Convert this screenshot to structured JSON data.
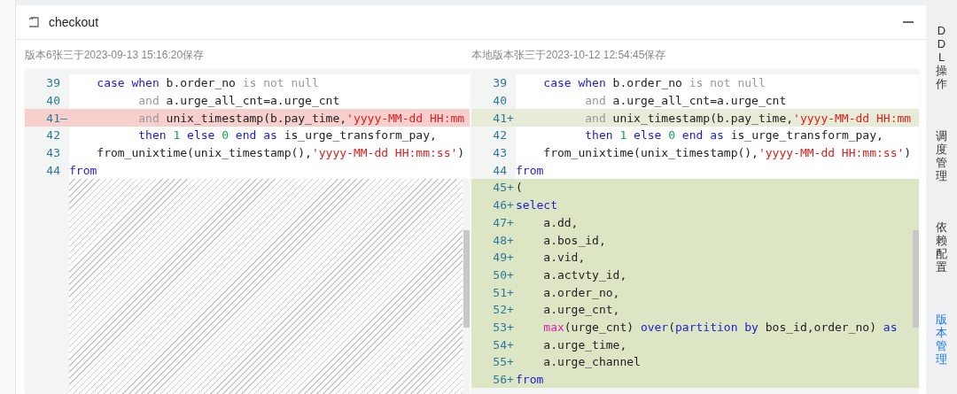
{
  "panel": {
    "title": "checkout"
  },
  "panes": [
    {
      "caption": "版本6张三于2023-09-13 15:16:20保存",
      "filler": true,
      "lines": [
        {
          "number": "39",
          "kind": "context",
          "tokens": [
            {
              "kind": "kw",
              "t": "    case when "
            },
            {
              "kind": "plain",
              "t": "b.order_no "
            },
            {
              "kind": "muted",
              "t": "is not null"
            }
          ]
        },
        {
          "number": "40",
          "kind": "context",
          "tokens": [
            {
              "kind": "muted",
              "t": "          and "
            },
            {
              "kind": "plain",
              "t": "a.urge_all_cnt=a.urge_cnt"
            }
          ]
        },
        {
          "number": "41",
          "marker": "—",
          "kind": "removed",
          "tokens": [
            {
              "kind": "muted",
              "t": "          and "
            },
            {
              "kind": "plain",
              "t": "unix_timestamp(b.pay_time,"
            },
            {
              "kind": "str",
              "t": "'yyyy-MM-dd HH:mm"
            }
          ]
        },
        {
          "number": "42",
          "kind": "context",
          "tokens": [
            {
              "kind": "kw",
              "t": "          then "
            },
            {
              "kind": "num",
              "t": "1 "
            },
            {
              "kind": "kw",
              "t": "else "
            },
            {
              "kind": "num",
              "t": "0 "
            },
            {
              "kind": "kw",
              "t": "end as "
            },
            {
              "kind": "plain",
              "t": "is_urge_transform_pay,"
            }
          ]
        },
        {
          "number": "43",
          "kind": "context",
          "tokens": [
            {
              "kind": "plain",
              "t": "    from_unixtime(unix_timestamp(),"
            },
            {
              "kind": "str",
              "t": "'yyyy-MM-dd HH:mm:ss'"
            },
            {
              "kind": "plain",
              "t": ")"
            }
          ]
        },
        {
          "number": "44",
          "kind": "context",
          "tokens": [
            {
              "kind": "kw",
              "t": "from"
            }
          ]
        }
      ]
    },
    {
      "caption": "本地版本张三于2023-10-12 12:54:45保存",
      "filler": false,
      "lines": [
        {
          "number": "39",
          "kind": "context",
          "tokens": [
            {
              "kind": "kw",
              "t": "    case when "
            },
            {
              "kind": "plain",
              "t": "b.order_no "
            },
            {
              "kind": "muted",
              "t": "is not null"
            }
          ]
        },
        {
          "number": "40",
          "kind": "context",
          "tokens": [
            {
              "kind": "muted",
              "t": "          and "
            },
            {
              "kind": "plain",
              "t": "a.urge_all_cnt=a.urge_cnt"
            }
          ]
        },
        {
          "number": "41",
          "marker": "+",
          "kind": "modified",
          "tokens": [
            {
              "kind": "muted",
              "t": "          and "
            },
            {
              "kind": "plain",
              "t": "unix_timestamp(b.pay_time,"
            },
            {
              "kind": "str",
              "t": "'yyyy-MM-dd HH:mm"
            }
          ]
        },
        {
          "number": "42",
          "kind": "context",
          "tokens": [
            {
              "kind": "kw",
              "t": "          then "
            },
            {
              "kind": "num",
              "t": "1 "
            },
            {
              "kind": "kw",
              "t": "else "
            },
            {
              "kind": "num",
              "t": "0 "
            },
            {
              "kind": "kw",
              "t": "end as "
            },
            {
              "kind": "plain",
              "t": "is_urge_transform_pay,"
            }
          ]
        },
        {
          "number": "43",
          "kind": "context",
          "tokens": [
            {
              "kind": "plain",
              "t": "    from_unixtime(unix_timestamp(),"
            },
            {
              "kind": "str",
              "t": "'yyyy-MM-dd HH:mm:ss'"
            },
            {
              "kind": "plain",
              "t": ")"
            }
          ]
        },
        {
          "number": "44",
          "kind": "context",
          "tokens": [
            {
              "kind": "kw",
              "t": "from"
            }
          ]
        },
        {
          "number": "45",
          "marker": "+",
          "kind": "added",
          "tokens": [
            {
              "kind": "plain",
              "t": "("
            }
          ]
        },
        {
          "number": "46",
          "marker": "+",
          "kind": "added",
          "tokens": [
            {
              "kind": "kw",
              "t": "select"
            }
          ]
        },
        {
          "number": "47",
          "marker": "+",
          "kind": "added",
          "tokens": [
            {
              "kind": "plain",
              "t": "    a.dd,"
            }
          ]
        },
        {
          "number": "48",
          "marker": "+",
          "kind": "added",
          "tokens": [
            {
              "kind": "plain",
              "t": "    a.bos_id,"
            }
          ]
        },
        {
          "number": "49",
          "marker": "+",
          "kind": "added",
          "tokens": [
            {
              "kind": "plain",
              "t": "    a.vid,"
            }
          ]
        },
        {
          "number": "50",
          "marker": "+",
          "kind": "added",
          "tokens": [
            {
              "kind": "plain",
              "t": "    a.actvty_id,"
            }
          ]
        },
        {
          "number": "51",
          "marker": "+",
          "kind": "added",
          "tokens": [
            {
              "kind": "plain",
              "t": "    a.order_no,"
            }
          ]
        },
        {
          "number": "52",
          "marker": "+",
          "kind": "added",
          "tokens": [
            {
              "kind": "plain",
              "t": "    a.urge_cnt,"
            }
          ]
        },
        {
          "number": "53",
          "marker": "+",
          "kind": "added",
          "tokens": [
            {
              "kind": "fn",
              "t": "    max"
            },
            {
              "kind": "plain",
              "t": "(urge_cnt) "
            },
            {
              "kind": "kw",
              "t": "over"
            },
            {
              "kind": "plain",
              "t": "("
            },
            {
              "kind": "kw",
              "t": "partition by "
            },
            {
              "kind": "plain",
              "t": "bos_id,order_no) "
            },
            {
              "kind": "kw",
              "t": "as"
            }
          ]
        },
        {
          "number": "54",
          "marker": "+",
          "kind": "added",
          "tokens": [
            {
              "kind": "plain",
              "t": "    a.urge_time,"
            }
          ]
        },
        {
          "number": "55",
          "marker": "+",
          "kind": "added",
          "tokens": [
            {
              "kind": "plain",
              "t": "    a.urge_channel"
            }
          ]
        },
        {
          "number": "56",
          "marker": "+",
          "kind": "added",
          "tokens": [
            {
              "kind": "kw",
              "t": "from"
            }
          ]
        }
      ]
    }
  ],
  "side_tabs": [
    {
      "label": "DDL操作",
      "selected": false
    },
    {
      "label": "调度管理",
      "selected": false
    },
    {
      "label": "依赖配置",
      "selected": false
    },
    {
      "label": "版本管理",
      "selected": true
    }
  ]
}
